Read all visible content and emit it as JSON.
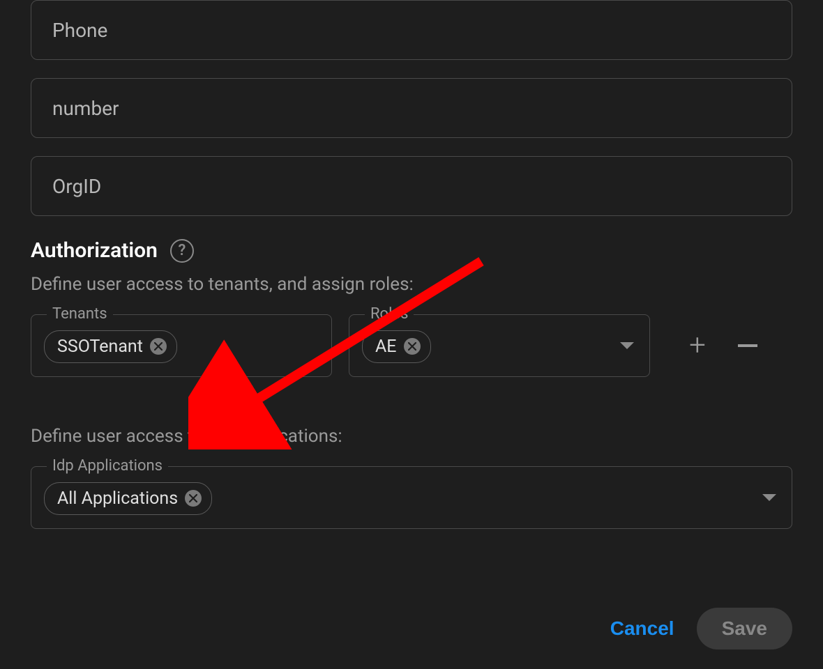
{
  "fields": {
    "phone": "Phone",
    "number": "number",
    "orgid": "OrgID"
  },
  "authorization": {
    "title": "Authorization",
    "subtitle_tenants": "Define user access to tenants, and assign roles:",
    "tenants_label": "Tenants",
    "roles_label": "Roles",
    "tenant_chip": "SSOTenant",
    "role_chip": "AE",
    "subtitle_idp": "Define user access to IdP applications:",
    "idp_label": "Idp Applications",
    "idp_chip": "All Applications"
  },
  "footer": {
    "cancel": "Cancel",
    "save": "Save"
  }
}
